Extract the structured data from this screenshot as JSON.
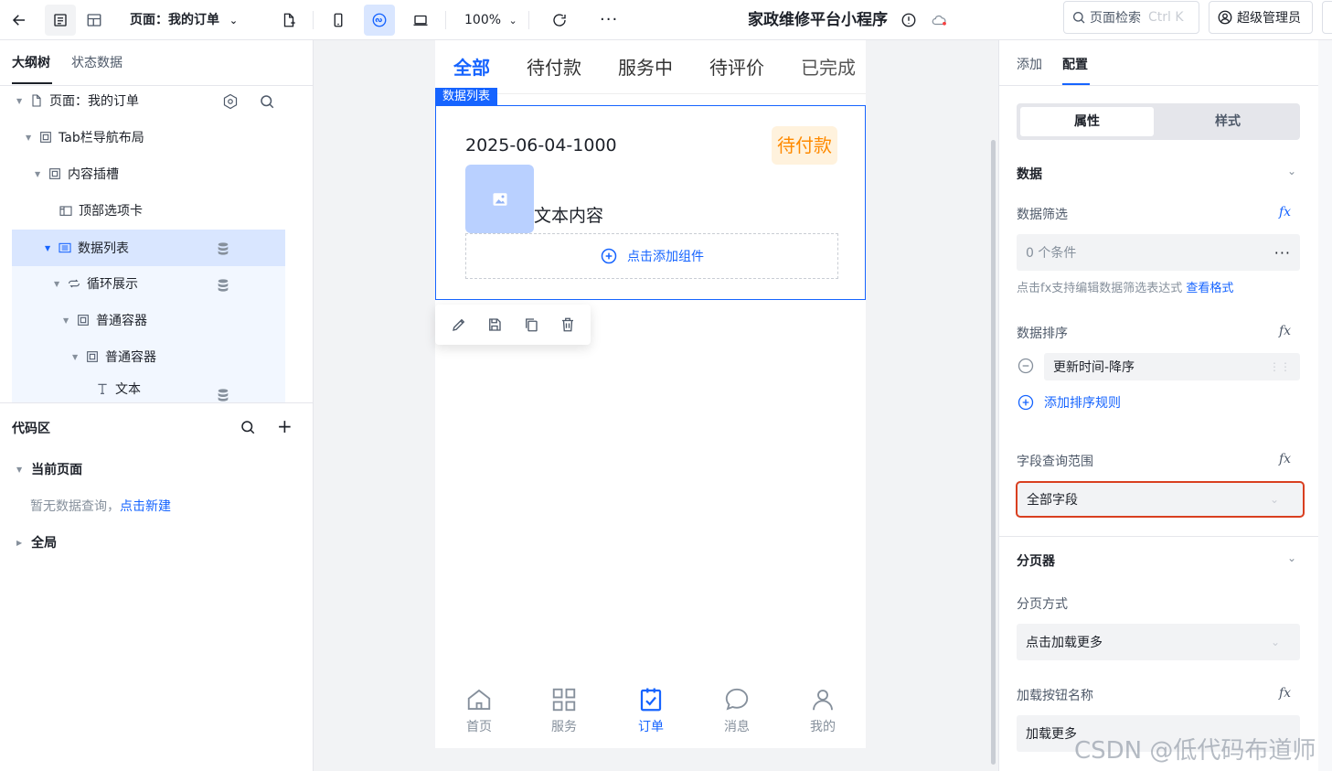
{
  "topbar": {
    "page_label": "页面：我的订单",
    "zoom": "100%",
    "app_title": "家政维修平台小程序",
    "search_label": "页面检索",
    "search_shortcut": "Ctrl K",
    "user_label": "超级管理员"
  },
  "left": {
    "tabs": [
      "大纲树",
      "状态数据"
    ],
    "tree": [
      {
        "label": "页面：我的订单"
      },
      {
        "label": "Tab栏导航布局"
      },
      {
        "label": "内容插槽"
      },
      {
        "label": "顶部选项卡"
      },
      {
        "label": "数据列表"
      },
      {
        "label": "循环展示"
      },
      {
        "label": "普通容器"
      },
      {
        "label": "普通容器"
      },
      {
        "label": "文本"
      }
    ],
    "code_area": {
      "title": "代码区",
      "current_page": "当前页面",
      "empty_text": "暂无数据查询，",
      "create_link": "点击新建",
      "global": "全局"
    }
  },
  "canvas": {
    "tabs": [
      "全部",
      "待付款",
      "服务中",
      "待评价",
      "已完成"
    ],
    "component_tag": "数据列表",
    "order": {
      "number": "2025-06-04-1000",
      "status": "待付款",
      "text": "文本内容",
      "add_component": "点击添加组件"
    },
    "tabbar": [
      "首页",
      "服务",
      "订单",
      "消息",
      "我的"
    ]
  },
  "right": {
    "tabs": [
      "添加",
      "配置"
    ],
    "segments": [
      "属性",
      "样式"
    ],
    "data_section": "数据",
    "filter_label": "数据筛选",
    "filter_value": "0 个条件",
    "filter_hint": "点击fx支持编辑数据筛选表达式",
    "filter_hint_link": "查看格式",
    "sort_label": "数据排序",
    "sort_value": "更新时间-降序",
    "add_sort": "添加排序规则",
    "range_label": "字段查询范围",
    "range_value": "全部字段",
    "pager_section": "分页器",
    "pager_mode_label": "分页方式",
    "pager_mode_value": "点击加载更多",
    "load_btn_label": "加载按钮名称",
    "load_btn_value": "加载更多",
    "fx": "fx"
  },
  "watermark": "CSDN @低代码布道师",
  "colors": {
    "accent": "#1664ff",
    "warning": "#ff8a00",
    "highlight_border": "#d93f20"
  }
}
